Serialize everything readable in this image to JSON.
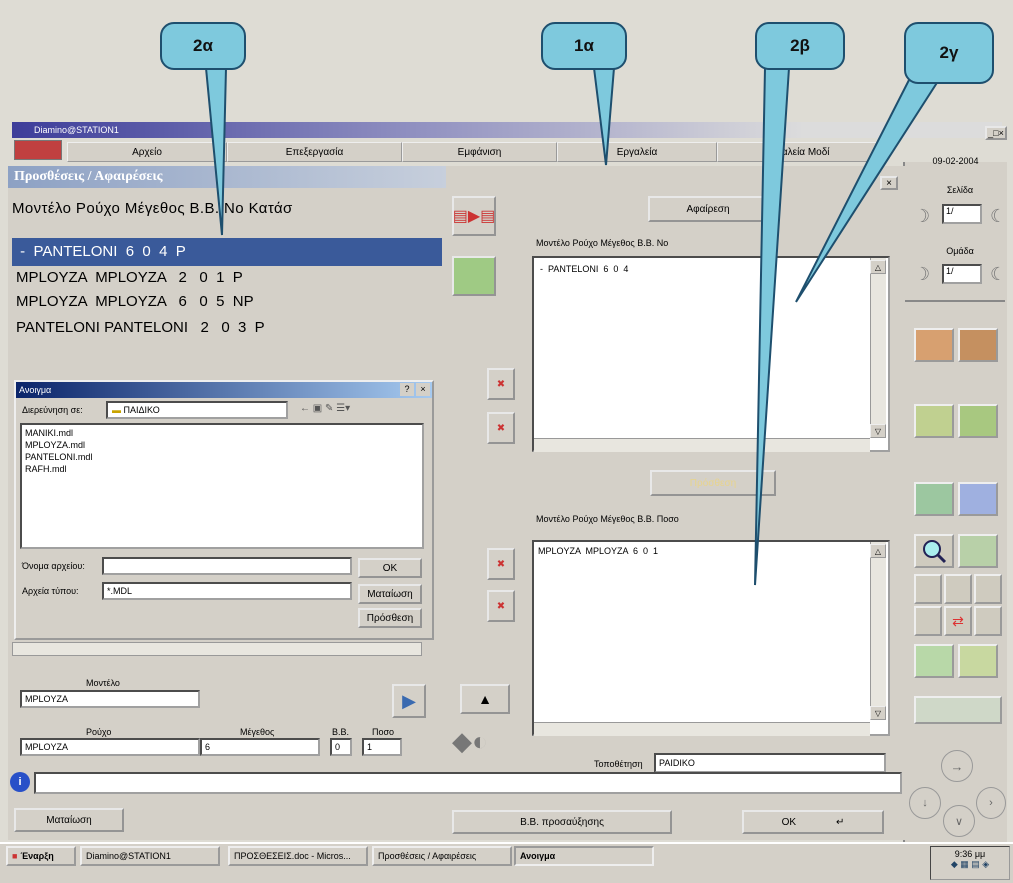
{
  "callouts": {
    "c1": "2α",
    "c2": "1α",
    "c3": "2β",
    "c4": "2γ"
  },
  "title_bar": "Diamino@STATION1",
  "menu": [
    "Αρχείο",
    "Επεξεργασία",
    "Εμφάνιση",
    "Εργαλεία",
    "Εργαλεία Μοδί"
  ],
  "right_panel": {
    "date": "09-02-2004",
    "page_label": "Σελίδα",
    "page_value": "1/",
    "group_label": "Ομάδα",
    "group_value": "1/"
  },
  "left_window": {
    "title": "Προσθέσεις / Αφαιρέσεις",
    "headers": "Μοντέλο Ρούχο Μέγεθος Β.Β. Νο Κατάσ",
    "rows": [
      " -  PANTELONI  6  0  4  P",
      "MPLOYZA  MPLOYZA   2   0  1  P",
      "MPLOYZA  MPLOYZA   6   0  5  NP",
      "PANTELONI PANTELONI   2   0  3  P"
    ]
  },
  "open_dialog": {
    "title": "Ανοιγμα",
    "help": "?",
    "close": "×",
    "look_in_label": "Διερεύνηση σε:",
    "look_in": "ΠΑΙΔΙΚΟ",
    "files": [
      "MANIKI.mdl",
      "MPLOYZA.mdl",
      "PANTELONI.mdl",
      "RAFH.mdl"
    ],
    "filename_label": "Όνομα αρχείου:",
    "filename": "",
    "filetype_label": "Αρχεία τύπου:",
    "filetype": "*.MDL",
    "ok": "OK",
    "cancel": "Ματαίωση",
    "add": "Πρόσθεση"
  },
  "form": {
    "model_label": "Μοντέλο",
    "model": "MPLOYZA",
    "garment_label": "Ρούχο",
    "garment": "MPLOYZA",
    "size_label": "Μέγεθος",
    "size": "6",
    "bb_label": "Β.Β.",
    "bb": "0",
    "qty_label": "Ποσο",
    "qty": "1"
  },
  "remove_btn": "Αφαίρεση",
  "list1": {
    "headers": "Μοντέλο Ρούχο Μέγεθος Β.Β. Νο",
    "rows": [
      "-  PANTELONI  6  0  4"
    ]
  },
  "add_btn": "Πρόσθεση",
  "list2": {
    "headers": "Μοντέλο Ρούχο Μέγεθος Β.Β. Ποσο",
    "rows": [
      "MPLOYZA  MPLOYZA  6  0  1"
    ]
  },
  "placement_label": "Τοποθέτηση",
  "placement": "PAIDIKO",
  "bottom": {
    "cancel": "Ματαίωση",
    "bb_step": "Β.Β. προσαύξησης",
    "ok": "OK"
  },
  "taskbar": {
    "start": "Έναρξη",
    "items": [
      "Diamino@STATION1",
      "ΠΡΟΣΘΕΣΕΙΣ.doc - Micros...",
      "Προσθέσεις / Αφαιρέσεις",
      "Ανοιγμα"
    ],
    "clock": "9:36 μμ"
  }
}
